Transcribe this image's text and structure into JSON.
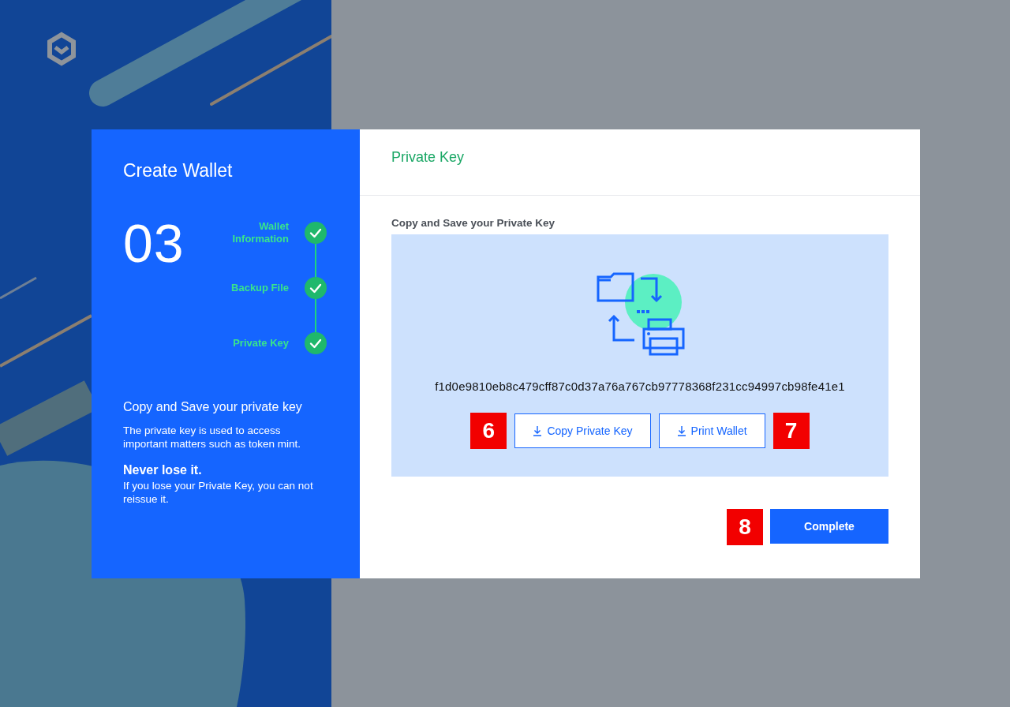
{
  "sidebar": {
    "title": "Create Wallet",
    "step_number": "03",
    "steps": [
      {
        "label": "Wallet Information",
        "done": true
      },
      {
        "label": "Backup File",
        "done": true
      },
      {
        "label": "Private Key",
        "done": true
      }
    ],
    "heading": "Copy and Save your private key",
    "description": "The private key is used to access important matters such as token mint.",
    "warning_title": "Never lose it.",
    "warning_text": "If you lose your Private Key, you can not reissue it."
  },
  "panel": {
    "title": "Private Key",
    "section_label": "Copy and Save your Private Key",
    "private_key": "f1d0e9810eb8c479cff87c0d37a76a767cb97778368f231cc94997cb98fe41e1",
    "actions": [
      {
        "kind": "callout",
        "label": "6"
      },
      {
        "kind": "outline",
        "label": "Copy Private Key"
      },
      {
        "kind": "outline",
        "label": "Print Wallet"
      },
      {
        "kind": "callout",
        "label": "7"
      }
    ],
    "footer": [
      {
        "kind": "callout",
        "label": "8"
      },
      {
        "kind": "primary",
        "label": "Complete"
      }
    ]
  }
}
